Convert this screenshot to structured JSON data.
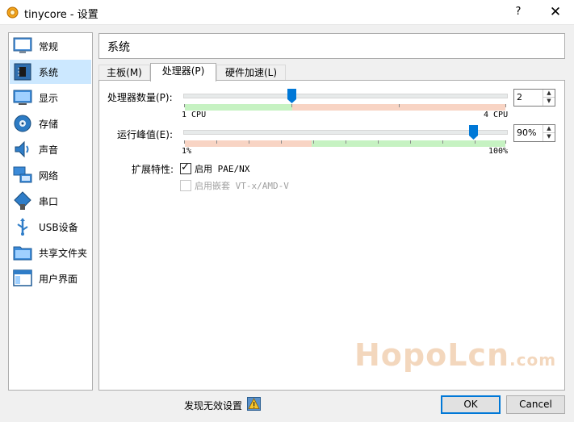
{
  "window": {
    "title": "tinycore - 设置",
    "help": "?",
    "close": "✕"
  },
  "sidebar": {
    "items": [
      {
        "label": "常规",
        "icon": "monitor-icon"
      },
      {
        "label": "系统",
        "icon": "chip-icon"
      },
      {
        "label": "显示",
        "icon": "display-icon"
      },
      {
        "label": "存储",
        "icon": "storage-icon"
      },
      {
        "label": "声音",
        "icon": "speaker-icon"
      },
      {
        "label": "网络",
        "icon": "network-icon"
      },
      {
        "label": "串口",
        "icon": "serial-port-icon"
      },
      {
        "label": "USB设备",
        "icon": "usb-icon"
      },
      {
        "label": "共享文件夹",
        "icon": "folder-icon"
      },
      {
        "label": "用户界面",
        "icon": "window-icon"
      }
    ],
    "selected_label": "系统"
  },
  "header": {
    "title": "系统"
  },
  "tabs": [
    {
      "label": "主板(M)",
      "active": false
    },
    {
      "label": "处理器(P)",
      "active": true
    },
    {
      "label": "硬件加速(L)",
      "active": false
    }
  ],
  "processor": {
    "cpu_label": "处理器数量(P):",
    "cpu_value": "2",
    "cpu_count": 2,
    "cpu_min": 1,
    "cpu_max": 4,
    "cpu_min_label": "1 CPU",
    "cpu_max_label": "4 CPU",
    "cap_label": "运行峰值(E):",
    "cap_value": "90%",
    "cap_percent": 90,
    "cap_min_label": "1%",
    "cap_max_label": "100%",
    "ext_label": "扩展特性:",
    "pae_label": "启用 PAE/NX",
    "pae_checked": true,
    "nested_label": "启用嵌套 VT-x/AMD-V",
    "nested_checked": false
  },
  "footer": {
    "invalid_settings": "发现无效设置",
    "ok": "OK",
    "cancel": "Cancel"
  },
  "watermark": {
    "main": "HopoLcn",
    "suffix": ".com"
  },
  "colors": {
    "selection": "#cce8ff",
    "accent": "#0078d7",
    "green_zone": "#c6f2c2",
    "red_zone": "#f8d4c4"
  }
}
